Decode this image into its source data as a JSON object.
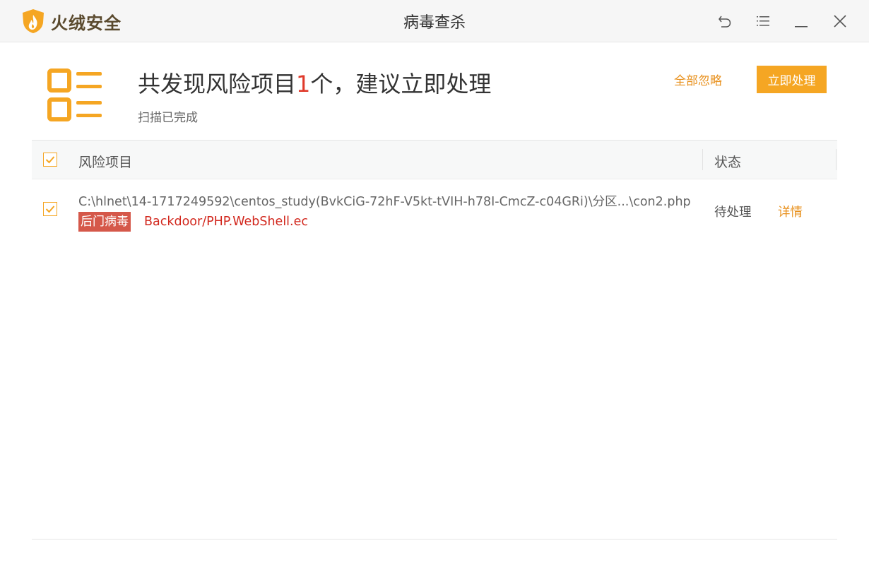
{
  "app": {
    "name": "火绒安全",
    "window_title": "病毒查杀"
  },
  "summary": {
    "headline_prefix": "共发现风险项目",
    "risk_count": "1",
    "headline_suffix": "个，建议立即处理",
    "status_text": "扫描已完成",
    "ignore_all_label": "全部忽略",
    "handle_now_label": "立即处理"
  },
  "table": {
    "columns": [
      "风险项目",
      "状态"
    ],
    "rows": [
      {
        "checked": true,
        "path": "C:\\hlnet\\14-1717249592\\centos_study(BvkCiG-72hF-V5kt-tVIH-h78I-CmcZ-c04GRi)\\分区...\\con2.php",
        "tag": "后门病毒",
        "virus_name": "Backdoor/PHP.WebShell.ec",
        "status": "待处理",
        "action": "详情"
      }
    ]
  },
  "colors": {
    "accent": "#f5a623",
    "danger": "#d2281e",
    "tag_bg": "#d5584a",
    "link": "#e8901c"
  },
  "icons": {
    "logo": "huorong-shield-flame-icon",
    "back": "undo-arrow-icon",
    "menu": "menu-list-icon",
    "minimize": "minimize-icon",
    "close": "close-icon",
    "summary": "risk-list-icon",
    "check": "checkmark-icon"
  }
}
